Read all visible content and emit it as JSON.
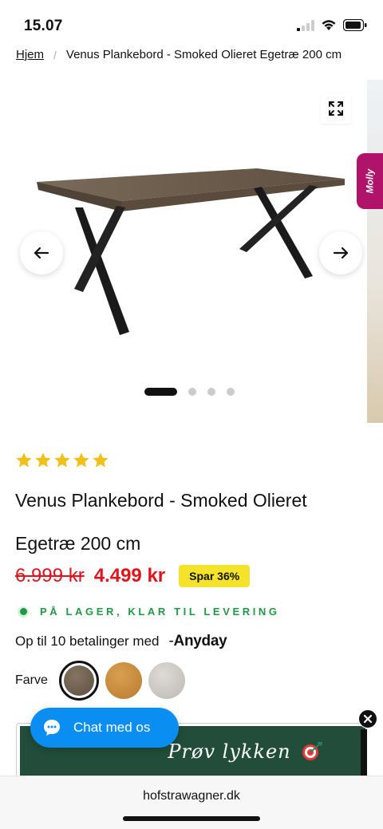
{
  "status_bar": {
    "time": "15.07"
  },
  "breadcrumb": {
    "home": "Hjem",
    "separator": "/",
    "current": "Venus Plankebord - Smoked Olieret Egetræ 200 cm"
  },
  "gallery": {
    "molly_tab": "Molly",
    "slide_count": 4,
    "active_slide": 1
  },
  "product": {
    "rating_stars": 5,
    "title": "Venus Plankebord - Smoked Olieret Egetræ 200 cm",
    "old_price": "6.999 kr",
    "new_price": "4.499 kr",
    "save_badge": "Spar 36%",
    "stock_status": "PÅ LAGER, KLAR TIL LEVERING",
    "payment_text": "Op til 10 betalinger med",
    "payment_provider": "Anyday",
    "color_label": "Farve",
    "color_swatches": [
      {
        "name": "smoked-oak",
        "color": "#6b5c4c",
        "selected": true
      },
      {
        "name": "natural-oak",
        "color": "#c98a3e",
        "selected": false
      },
      {
        "name": "white-oak",
        "color": "#cfcac4",
        "selected": false
      }
    ]
  },
  "banner": {
    "text": "Prøv lykken"
  },
  "chat": {
    "label": "Chat med os"
  },
  "browser": {
    "url": "hofstrawagner.dk"
  },
  "colors": {
    "price_red": "#e1141c",
    "stock_green": "#1f9a44",
    "badge_yellow": "#f4e32a",
    "chat_blue": "#0a8ef2",
    "banner_green": "#214d3a",
    "molly_magenta": "#b0146a"
  }
}
